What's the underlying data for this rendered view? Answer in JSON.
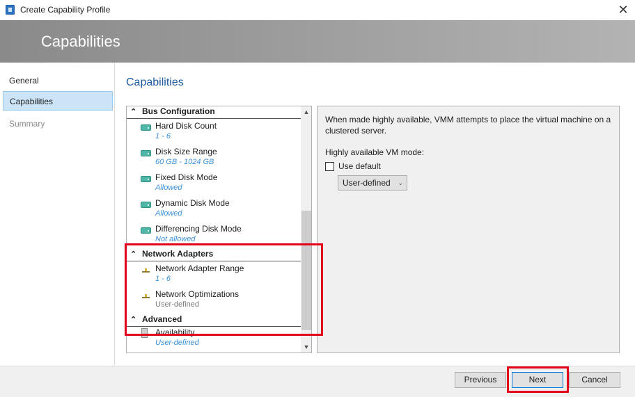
{
  "window": {
    "title": "Create Capability Profile"
  },
  "banner": {
    "title": "Capabilities"
  },
  "nav": {
    "items": [
      {
        "label": "General",
        "state": "normal"
      },
      {
        "label": "Capabilities",
        "state": "selected"
      },
      {
        "label": "Summary",
        "state": "disabled"
      }
    ]
  },
  "content": {
    "title": "Capabilities"
  },
  "list": {
    "groups": [
      {
        "label": "Bus Configuration"
      },
      {
        "label": "Network Adapters"
      },
      {
        "label": "Advanced"
      }
    ],
    "items": [
      {
        "name": "Hard Disk Count",
        "value": "1 - 6",
        "icon": "disk-icon"
      },
      {
        "name": "Disk Size Range",
        "value": "60  GB - 1024  GB",
        "icon": "disk-icon"
      },
      {
        "name": "Fixed Disk Mode",
        "value": "Allowed",
        "icon": "disk-icon"
      },
      {
        "name": "Dynamic Disk Mode",
        "value": "Allowed",
        "icon": "disk-icon"
      },
      {
        "name": "Differencing Disk Mode",
        "value": "Not allowed",
        "icon": "disk-icon"
      },
      {
        "name": "Network Adapter Range",
        "value": "1 - 6",
        "icon": "network-icon"
      },
      {
        "name": "Network Optimizations",
        "value": "User-defined",
        "icon": "network-icon"
      },
      {
        "name": "Availability",
        "value": "User-defined",
        "icon": "availability-icon"
      }
    ]
  },
  "detail": {
    "description": "When made highly available, VMM attempts to place the virtual machine on a clustered server.",
    "mode_label": "Highly available VM mode:",
    "use_default_label": "Use default",
    "use_default_checked": false,
    "mode_select_value": "User-defined"
  },
  "footer": {
    "previous_label": "Previous",
    "next_label": "Next",
    "cancel_label": "Cancel"
  },
  "colors": {
    "highlight": "#e3001b",
    "accent": "#1e5aa0",
    "value_text": "#3a8fd8"
  }
}
